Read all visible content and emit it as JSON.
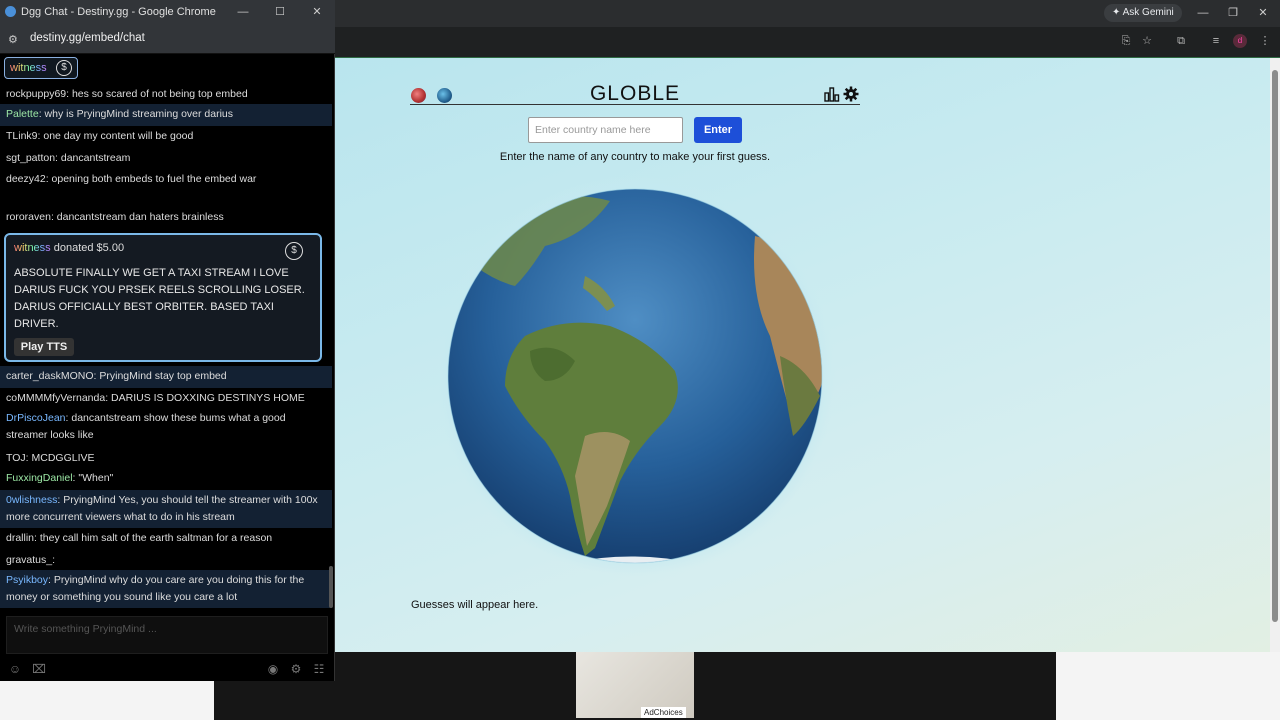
{
  "main_window": {
    "ask_gemini": "Ask Gemini",
    "profile_initial": "d",
    "toolbar_icons": [
      "install-icon",
      "star-icon",
      "extensions-icon",
      "media-icon",
      "profile-icon",
      "menu-icon"
    ]
  },
  "globle": {
    "title": "GLOBLE",
    "input_placeholder": "Enter country name here",
    "enter_label": "Enter",
    "instructions": "Enter the name of any country to make your first guess.",
    "guesses_placeholder": "Guesses will appear here.",
    "header_icons": [
      "globe-colored-icon",
      "globe-icon",
      "stats-icon",
      "gear-icon"
    ]
  },
  "ad": {
    "adchoices": "AdChoices"
  },
  "chat_window": {
    "title": "Dgg Chat - Destiny.gg - Google Chrome",
    "url": "destiny.gg/embed/chat",
    "pinned_user": "witness",
    "messages": [
      {
        "user": "rockpuppy69",
        "color": "#dddddd",
        "text": ": hes so scared of not being top embed",
        "hl": false
      },
      {
        "user": "Palette",
        "color": "#9ce7a5",
        "text": ": why is PryingMind streaming over darius",
        "hl": true
      },
      {
        "user": "TLink9",
        "color": "#dddddd",
        "text": ": one day my content will be good",
        "hl": false
      },
      {
        "user": "sgt_patton",
        "color": "#dddddd",
        "text": ": dancantstream",
        "hl": false
      },
      {
        "user": "deezy42",
        "color": "#dddddd",
        "text": ":  opening both embeds to fuel the embed war",
        "hl": false
      },
      {
        "user": "rororaven",
        "color": "#dddddd",
        "text": ": dancantstream dan haters brainless",
        "hl": false
      }
    ],
    "donation": {
      "user": "witness",
      "header": " donated $5.00",
      "body": "ABSOLUTE FINALLY WE GET A TAXI STREAM I LOVE DARIUS FUCK YOU PRSEK REELS SCROLLING LOSER. DARIUS OFFICIALLY BEST ORBITER. BASED TAXI DRIVER.",
      "tts_label": "Play TTS"
    },
    "messages2": [
      {
        "user": "carter_daskMONO",
        "color": "#dddddd",
        "text": ": PryingMind  stay top embed",
        "hl": true
      },
      {
        "user": "coMMMMfyVernanda",
        "color": "#dddddd",
        "text": ":  DARIUS IS DOXXING DESTINYS HOME",
        "hl": false
      },
      {
        "user": "DrPiscoJean",
        "color": "#79b8ff",
        "text": ": dancantstream show these bums what a good streamer looks like",
        "hl": false
      },
      {
        "user": "TOJ",
        "color": "#dddddd",
        "text": ":  MCDGGLIVE",
        "hl": false
      },
      {
        "user": "FuxxingDaniel",
        "color": "#9ce7a5",
        "text": ": \"When\"",
        "hl": false
      },
      {
        "user": "0wlishness",
        "color": "#79b8ff",
        "text": ": PryingMind Yes, you should tell the streamer with 100x more concurrent viewers what to do in his stream",
        "hl": true
      },
      {
        "user": "drallin",
        "color": "#dddddd",
        "text": ": they call him salt of the earth saltman for a reason",
        "hl": false
      },
      {
        "user": "gravatus_",
        "color": "#dddddd",
        "text": ":",
        "hl": false
      },
      {
        "user": "Psyikboy",
        "color": "#79b8ff",
        "text": ": PryingMind why do you care are you doing this for the money or something you sound like you care a lot",
        "hl": true
      }
    ],
    "input_placeholder": "Write something PryingMind ...",
    "footer_icons": [
      "emoji-icon",
      "whispers-icon",
      "watch-icon",
      "settings-icon",
      "users-icon"
    ]
  }
}
